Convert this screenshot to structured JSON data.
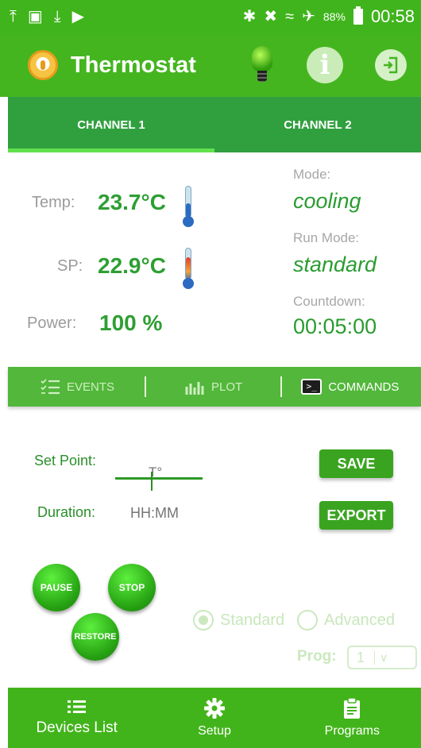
{
  "status_bar": {
    "battery_percent": "88%",
    "time": "00:58"
  },
  "app_bar": {
    "title": "Thermostat"
  },
  "channels": {
    "tabs": [
      {
        "label": "CHANNEL 1",
        "active": true
      },
      {
        "label": "CHANNEL 2",
        "active": false
      }
    ]
  },
  "readings": {
    "temp_label": "Temp:",
    "temp_value": "23.7°C",
    "sp_label": "SP:",
    "sp_value": "22.9°C",
    "power_label": "Power:",
    "power_value": "100 %",
    "mode_label": "Mode:",
    "mode_value": "cooling",
    "run_mode_label": "Run Mode:",
    "run_mode_value": "standard",
    "countdown_label": "Countdown:",
    "countdown_value": "00:05:00"
  },
  "toolbar": {
    "events": "EVENTS",
    "plot": "PLOT",
    "commands": "COMMANDS",
    "active": "COMMANDS"
  },
  "commands": {
    "set_point_label": "Set Point:",
    "set_point_placeholder": "T°",
    "duration_label": "Duration:",
    "duration_placeholder": "HH:MM",
    "save": "SAVE",
    "export": "EXPORT",
    "pause": "PAUSE",
    "stop": "STOP",
    "restore": "RESTORE",
    "mode_standard": "Standard",
    "mode_advanced": "Advanced",
    "selected_mode": "Standard",
    "prog_label": "Prog:",
    "prog_value": "1"
  },
  "bottom_nav": {
    "devices": "Devices List",
    "setup": "Setup",
    "programs": "Programs"
  },
  "colors": {
    "primary_green": "#44b51f",
    "value_green": "#2e9f33",
    "tab_green": "#30a03f"
  }
}
